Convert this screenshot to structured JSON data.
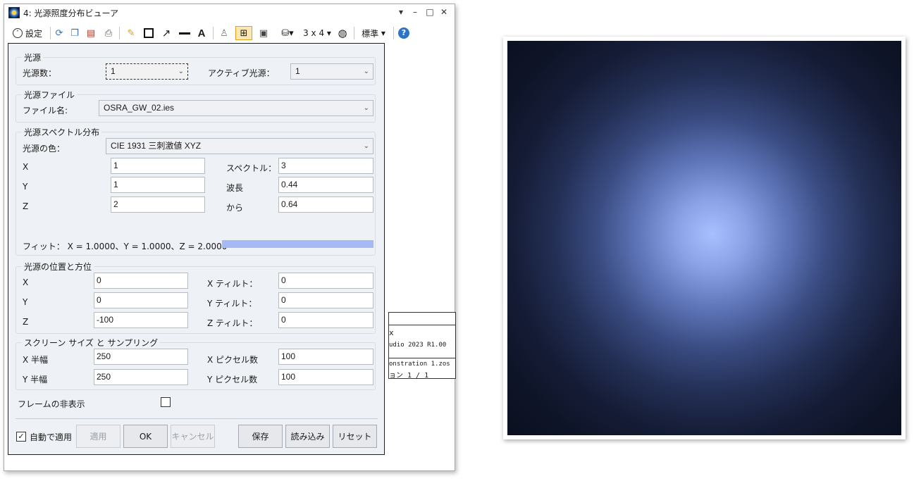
{
  "window": {
    "title": "4: 光源照度分布ビューア"
  },
  "toolbar": {
    "settings_label": "設定",
    "layout_label": "3 x 4",
    "standard_label": "標準"
  },
  "source": {
    "group_title": "光源",
    "count_label": "光源数：",
    "count_value": "1",
    "active_label": "アクティブ光源：",
    "active_value": "1"
  },
  "source_file": {
    "group_title": "光源ファイル",
    "file_label": "ファイル名:",
    "file_value": "OSRA_GW_02.ies"
  },
  "spectrum": {
    "group_title": "光源スペクトル分布",
    "color_label": "光源の色：",
    "color_value": "CIE 1931 三刺激値 XYZ",
    "x_label": "X",
    "x_value": "1",
    "y_label": "Y",
    "y_value": "1",
    "z_label": "Z",
    "z_value": "2",
    "spectrum_label": "スペクトル：",
    "spectrum_value": "3",
    "wave_label": "波長",
    "wave_value": "0.44",
    "to_label": "から",
    "to_value": "0.64",
    "fit_text": "フィット： X = 1.0000、Y = 1.0000、Z = 2.0000",
    "fit_color": "#a4b9f5"
  },
  "position": {
    "group_title": "光源の位置と方位",
    "x_label": "X",
    "x_value": "0",
    "y_label": "Y",
    "y_value": "0",
    "z_label": "Z",
    "z_value": "-100",
    "xtilt_label": "X ティルト：",
    "xtilt_value": "0",
    "ytilt_label": "Y ティルト：",
    "ytilt_value": "0",
    "ztilt_label": "Z ティルト：",
    "ztilt_value": "0"
  },
  "screen": {
    "group_title": "スクリーン サイズ と サンプリング",
    "xhalf_label": "X 半幅",
    "xhalf_value": "250",
    "yhalf_label": "Y 半幅",
    "yhalf_value": "250",
    "xpix_label": "X ピクセル数",
    "xpix_value": "100",
    "ypix_label": "Y ピクセル数",
    "ypix_value": "100"
  },
  "frame": {
    "hide_label": "フレームの非表示",
    "hide_checked": false
  },
  "buttons": {
    "auto_apply_label": "自動で適用",
    "auto_apply_checked": true,
    "apply": "適用",
    "ok": "OK",
    "cancel": "キャンセル",
    "save": "保存",
    "load": "読み込み",
    "reset": "リセット"
  },
  "background_panel": {
    "line1": "x",
    "line2": "udio 2023 R1.00",
    "line3": "onstration 1.zos",
    "line4": "ョン 1 / 1"
  }
}
